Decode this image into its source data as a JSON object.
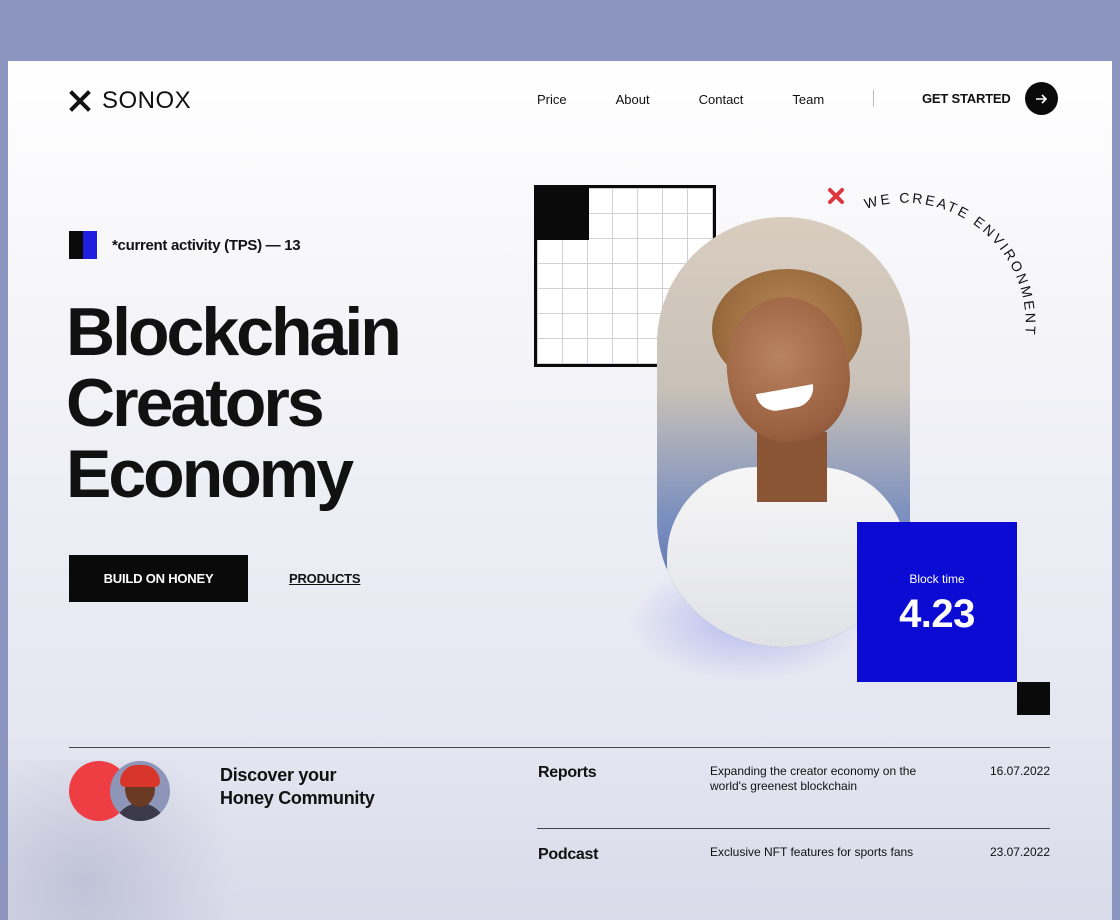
{
  "brand": {
    "name": "SONOX"
  },
  "nav": {
    "items": [
      "Price",
      "About",
      "Contact",
      "Team"
    ],
    "cta_label": "GET STARTED"
  },
  "hero": {
    "activity_text": "*current activity (TPS) — 13",
    "headline": [
      "Blockchain",
      "Creators",
      "Economy"
    ],
    "primary_button": "BUILD ON HONEY",
    "secondary_link": "PRODUCTS",
    "arc_text": "WE CREATE ENVIRONMENT",
    "block_label": "Block time",
    "block_value": "4.23"
  },
  "community": {
    "title_line1": "Discover your",
    "title_line2": "Honey Community"
  },
  "feed": [
    {
      "title": "Reports",
      "description": "Expanding the creator economy on the world's greenest blockchain",
      "date": "16.07.2022"
    },
    {
      "title": "Podcast",
      "description": "Exclusive NFT features for sports fans",
      "date": "23.07.2022"
    }
  ],
  "colors": {
    "accent_blue": "#0b0bd4",
    "accent_red": "#ee3d43",
    "background_outer": "#8b95c0"
  }
}
